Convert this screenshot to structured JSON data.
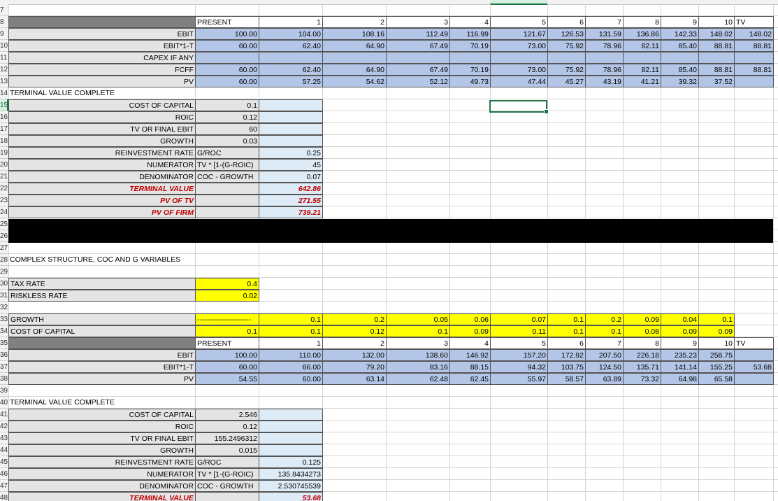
{
  "row_numbers": [
    "7",
    "8",
    "9",
    "10",
    "11",
    "12",
    "13",
    "14",
    "15",
    "16",
    "17",
    "18",
    "19",
    "20",
    "21",
    "22",
    "23",
    "24",
    "25",
    "26",
    "27",
    "28",
    "29",
    "30",
    "31",
    "32",
    "33",
    "34",
    "35",
    "36",
    "37",
    "38",
    "39",
    "40",
    "41",
    "42",
    "43",
    "44",
    "45",
    "46",
    "47",
    "48"
  ],
  "active_row": "15",
  "colors": {
    "gray": "#808080",
    "blue": "#b4c6e7",
    "light_blue": "#ddebf7",
    "yellow": "#ffff00",
    "red": "#c00000",
    "selection": "#217346"
  },
  "model1": {
    "header_present": "PRESENT",
    "years": [
      "1",
      "2",
      "3",
      "4",
      "5",
      "6",
      "7",
      "8",
      "9",
      "10"
    ],
    "tv_label": "TV",
    "rows": [
      {
        "label": "EBIT",
        "values": [
          "100.00",
          "104.00",
          "108.16",
          "112.49",
          "116.99",
          "121.67",
          "126.53",
          "131.59",
          "136.86",
          "142.33",
          "148.02",
          "148.02"
        ]
      },
      {
        "label": "EBIT*1-T",
        "values": [
          "60.00",
          "62.40",
          "64.90",
          "67.49",
          "70.19",
          "73.00",
          "75.92",
          "78.96",
          "82.11",
          "85.40",
          "88.81",
          "88.81"
        ]
      },
      {
        "label": "CAPEX IF ANY",
        "values": [
          "",
          "",
          "",
          "",
          "",
          "",
          "",
          "",
          "",
          "",
          "",
          ""
        ]
      },
      {
        "label": "FCFF",
        "values": [
          "60.00",
          "62.40",
          "64.90",
          "67.49",
          "70.19",
          "73.00",
          "75.92",
          "78.96",
          "82.11",
          "85.40",
          "88.81",
          "88.81"
        ]
      },
      {
        "label": "PV",
        "values": [
          "60.00",
          "57.25",
          "54.62",
          "52.12",
          "49.73",
          "47.44",
          "45.27",
          "43.19",
          "41.21",
          "39.32",
          "37.52",
          ""
        ]
      }
    ]
  },
  "tv1": {
    "title": "TERMINAL VALUE COMPLETE",
    "rows": [
      {
        "label": "COST OF CAPITAL",
        "note": "",
        "b": "0.1",
        "c": ""
      },
      {
        "label": "ROIC",
        "note": "",
        "b": "0.12",
        "c": ""
      },
      {
        "label": "TV OR FINAL EBIT",
        "note": "",
        "b": "60",
        "c": ""
      },
      {
        "label": "GROWTH",
        "note": "",
        "b": "0.03",
        "c": ""
      },
      {
        "label": "REINVESTMENT RATE",
        "note": "G/ROC",
        "b": "",
        "c": "0.25"
      },
      {
        "label": "NUMERATOR",
        "note": "TV * [1-(G-ROIC)",
        "b": "",
        "c": "45"
      },
      {
        "label": "DENOMINATOR",
        "note": "COC - GROWTH",
        "b": "",
        "c": "0.07"
      },
      {
        "label": "TERMINAL VALUE",
        "note": "",
        "b": "",
        "c": "642.86"
      },
      {
        "label": "PV OF TV",
        "note": "",
        "b": "",
        "c": "271.55"
      },
      {
        "label": "PV OF FIRM",
        "note": "",
        "b": "",
        "c": "739.21"
      }
    ]
  },
  "complex": {
    "title": "COMPLEX STRUCTURE, COC AND G VARIABLES",
    "tax_label": "TAX RATE",
    "tax_value": "0.4",
    "riskless_label": "RISKLESS RATE",
    "riskless_value": "0.02",
    "growth_label": "GROWTH",
    "growth_b": "----------------------",
    "growth": [
      "0.1",
      "0.2",
      "0.05",
      "0.06",
      "0.07",
      "0.1",
      "0.2",
      "0.09",
      "0.04",
      "0.1"
    ],
    "coc_label": "COST OF CAPITAL",
    "coc_b": "0.1",
    "coc": [
      "0.1",
      "0.12",
      "0.1",
      "0.09",
      "0.11",
      "0.1",
      "0.1",
      "0.08",
      "0.09",
      "0.09"
    ]
  },
  "model2": {
    "header_present": "PRESENT",
    "years": [
      "1",
      "2",
      "3",
      "4",
      "5",
      "6",
      "7",
      "8",
      "9",
      "10"
    ],
    "tv_label": "TV",
    "rows": [
      {
        "label": "EBIT",
        "values": [
          "100.00",
          "110.00",
          "132.00",
          "138.60",
          "146.92",
          "157.20",
          "172.92",
          "207.50",
          "226.18",
          "235.23",
          "258.75",
          ""
        ]
      },
      {
        "label": "EBIT*1-T",
        "values": [
          "60.00",
          "66.00",
          "79.20",
          "83.16",
          "88.15",
          "94.32",
          "103.75",
          "124.50",
          "135.71",
          "141.14",
          "155.25",
          "53.68"
        ]
      },
      {
        "label": "PV",
        "values": [
          "54.55",
          "60.00",
          "63.14",
          "62.48",
          "62.45",
          "55.97",
          "58.57",
          "63.89",
          "73.32",
          "64.98",
          "65.58",
          ""
        ]
      }
    ]
  },
  "tv2": {
    "title": "TERMINAL VALUE COMPLETE",
    "rows": [
      {
        "label": "COST OF CAPITAL",
        "note": "",
        "b": "2.546",
        "c": ""
      },
      {
        "label": "ROIC",
        "note": "",
        "b": "0.12",
        "c": ""
      },
      {
        "label": "TV OR FINAL EBIT",
        "note": "",
        "b": "155.2496312",
        "c": ""
      },
      {
        "label": "GROWTH",
        "note": "",
        "b": "0.015",
        "c": ""
      },
      {
        "label": "REINVESTMENT RATE",
        "note": "G/ROC",
        "b": "",
        "c": "0.125"
      },
      {
        "label": "NUMERATOR",
        "note": "TV * [1-(G-ROIC)",
        "b": "",
        "c": "135.8434273"
      },
      {
        "label": "DENOMINATOR",
        "note": "COC - GROWTH",
        "b": "",
        "c": "2.530745539"
      },
      {
        "label": "TERMINAL VALUE",
        "note": "",
        "b": "",
        "c": "53.68"
      }
    ]
  }
}
